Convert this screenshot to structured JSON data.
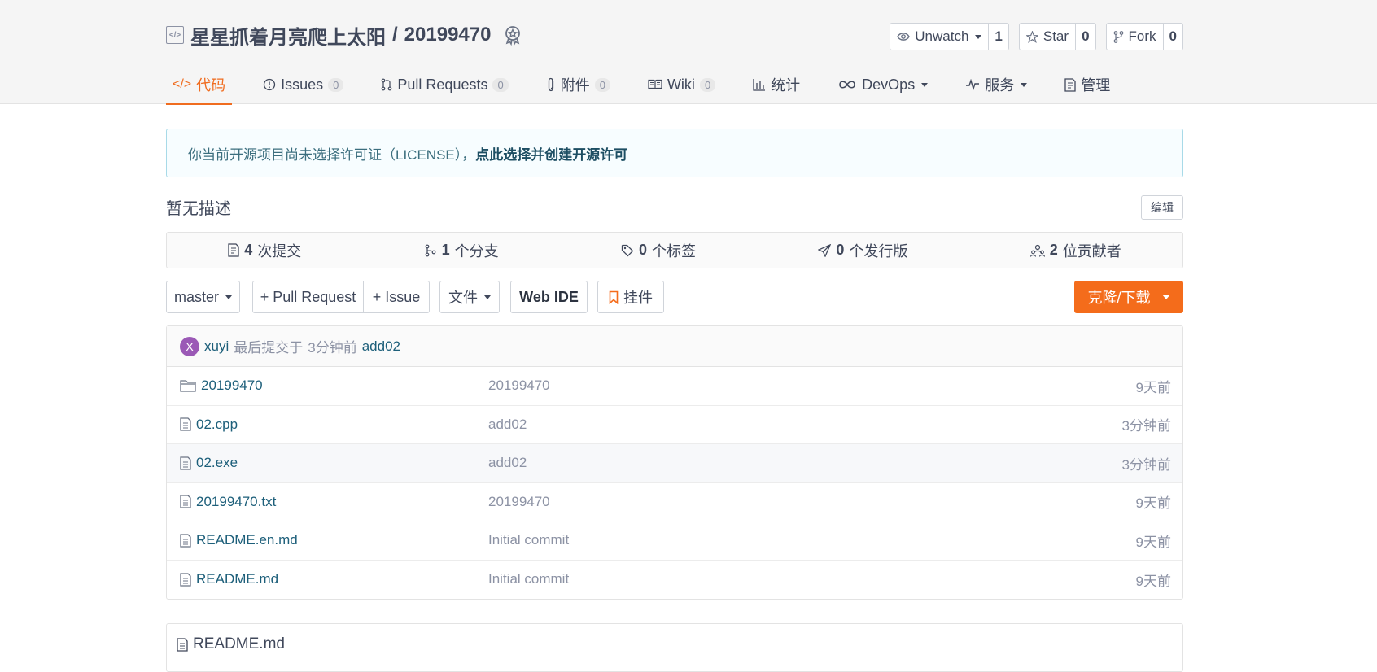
{
  "repo": {
    "owner": "星星抓着月亮爬上太阳",
    "separator": "/",
    "name": "20199470"
  },
  "top_buttons": {
    "watch": {
      "label": "Unwatch",
      "count": "1"
    },
    "star": {
      "label": "Star",
      "count": "0"
    },
    "fork": {
      "label": "Fork",
      "count": "0"
    }
  },
  "tabs": [
    {
      "label": "代码"
    },
    {
      "label": "Issues",
      "count": "0"
    },
    {
      "label": "Pull Requests",
      "count": "0"
    },
    {
      "label": "附件",
      "count": "0"
    },
    {
      "label": "Wiki",
      "count": "0"
    },
    {
      "label": "统计"
    },
    {
      "label": "DevOps"
    },
    {
      "label": "服务"
    },
    {
      "label": "管理"
    }
  ],
  "license_notice": {
    "text": "你当前开源项目尚未选择许可证（LICENSE），",
    "link": "点此选择并创建开源许可"
  },
  "description": "暂无描述",
  "edit_label": "编辑",
  "stats": [
    {
      "num": "4",
      "label": "次提交"
    },
    {
      "num": "1",
      "label": "个分支"
    },
    {
      "num": "0",
      "label": "个标签"
    },
    {
      "num": "0",
      "label": "个发行版"
    },
    {
      "num": "2",
      "label": "位贡献者"
    }
  ],
  "toolbar": {
    "branch": "master",
    "pull_request": "+ Pull Request",
    "issue": "+ Issue",
    "file": "文件",
    "web_ide": "Web IDE",
    "widget": "挂件",
    "clone": "克隆/下载"
  },
  "last_commit": {
    "avatar_letter": "X",
    "author": "xuyi",
    "text": "最后提交于",
    "time": "3分钟前",
    "message": "add02"
  },
  "files": [
    {
      "type": "folder",
      "name": "20199470",
      "message": "20199470",
      "time": "9天前"
    },
    {
      "type": "file",
      "name": "02.cpp",
      "message": "add02",
      "time": "3分钟前"
    },
    {
      "type": "file",
      "name": "02.exe",
      "message": "add02",
      "time": "3分钟前"
    },
    {
      "type": "file",
      "name": "20199470.txt",
      "message": "20199470",
      "time": "9天前"
    },
    {
      "type": "file",
      "name": "README.en.md",
      "message": "Initial commit",
      "time": "9天前"
    },
    {
      "type": "file",
      "name": "README.md",
      "message": "Initial commit",
      "time": "9天前"
    }
  ],
  "readme_title": "README.md",
  "colors": {
    "accent": "#f06c1f",
    "link": "#1d5f7a",
    "clone_bg": "#f46c1b"
  }
}
